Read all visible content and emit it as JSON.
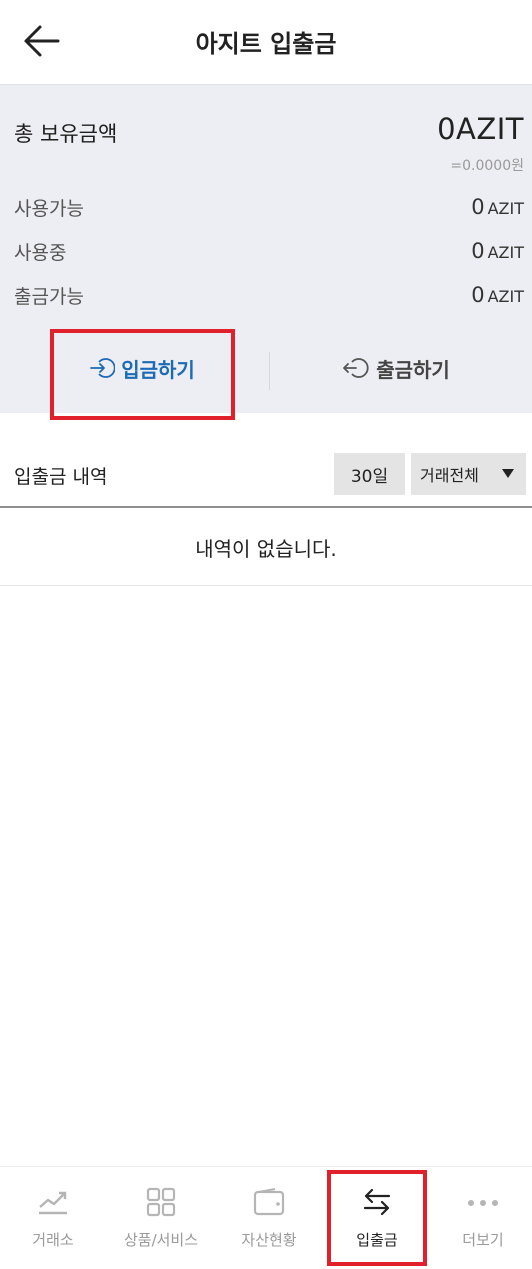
{
  "header": {
    "title": "아지트 입출금",
    "back_icon": "arrow-left-icon"
  },
  "summary": {
    "total_label": "총 보유금액",
    "total_value": "0AZIT",
    "total_krw": "=0.0000원",
    "rows": [
      {
        "label": "사용가능",
        "amount": "0",
        "unit": "AZIT"
      },
      {
        "label": "사용중",
        "amount": "0",
        "unit": "AZIT"
      },
      {
        "label": "출금가능",
        "amount": "0",
        "unit": "AZIT"
      }
    ],
    "deposit_label": "입금하기",
    "withdraw_label": "출금하기",
    "deposit_color": "#1c6ab5"
  },
  "history": {
    "title": "입출금 내역",
    "period": "30일",
    "type_filter": "거래전체",
    "empty_message": "내역이 없습니다."
  },
  "tabbar": {
    "tabs": [
      {
        "label": "거래소",
        "icon": "trend-chart-icon"
      },
      {
        "label": "상품/서비스",
        "icon": "grid-icon"
      },
      {
        "label": "자산현황",
        "icon": "wallet-icon"
      },
      {
        "label": "입출금",
        "icon": "transfer-arrows-icon",
        "active": true
      },
      {
        "label": "더보기",
        "icon": "more-dots-icon"
      }
    ]
  },
  "highlight_color": "#e0202a"
}
